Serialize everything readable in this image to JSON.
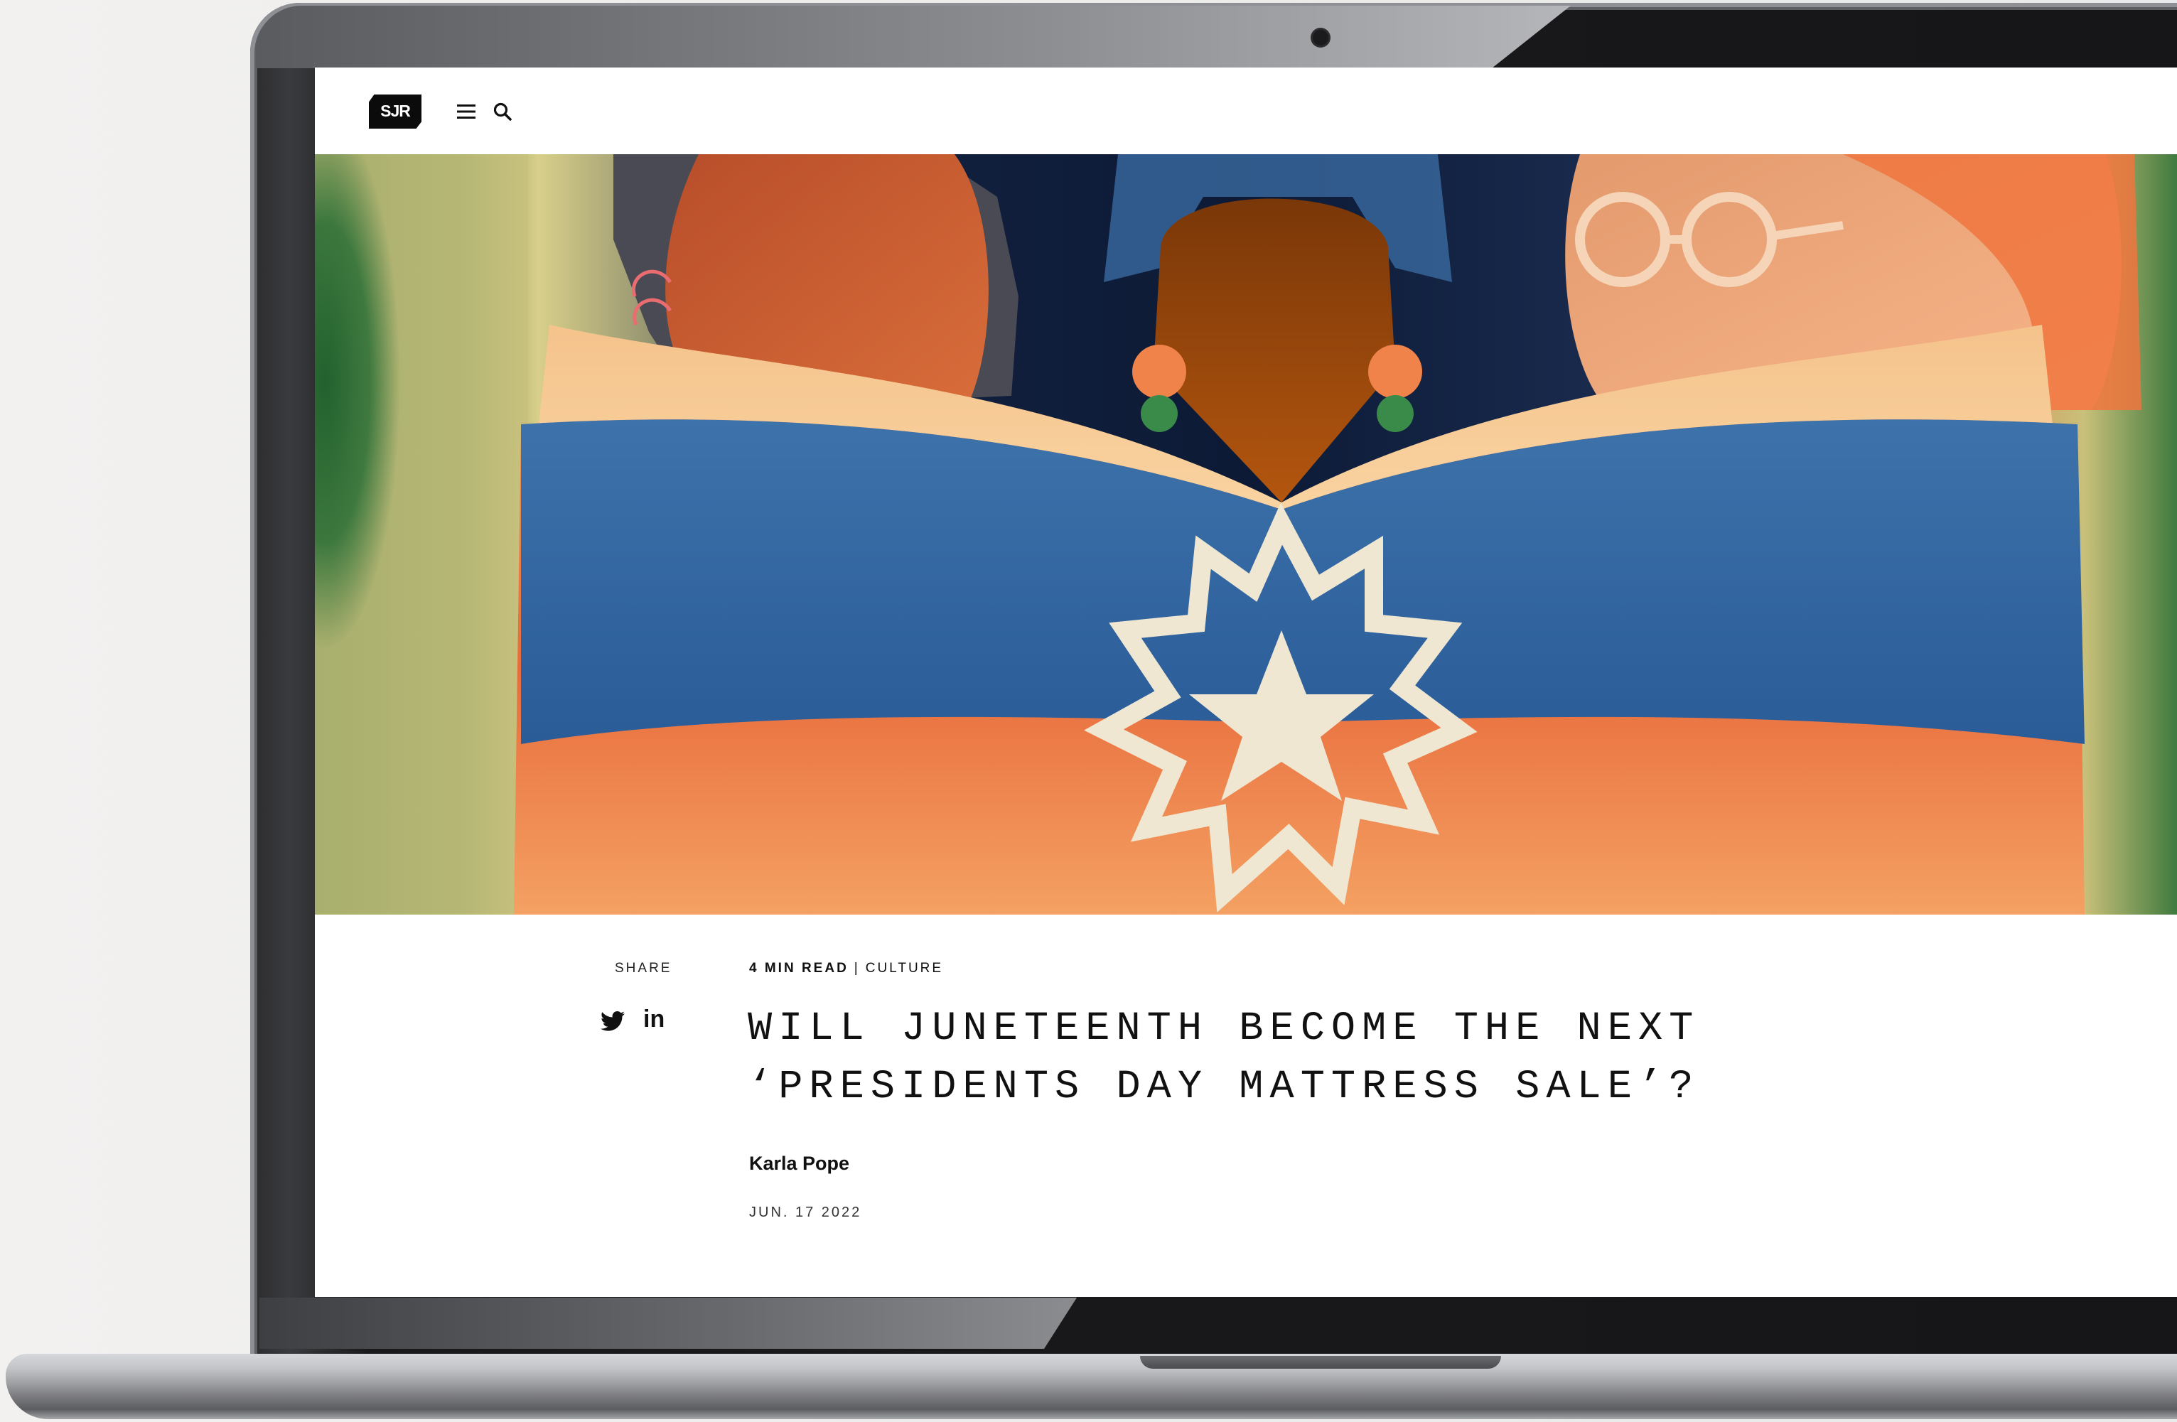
{
  "site": {
    "logo_text": "SJR"
  },
  "nav": {
    "menu_icon": "hamburger-icon",
    "search_icon": "search-icon"
  },
  "hero": {
    "description_icon": "illustration-juneteenth"
  },
  "share": {
    "label": "SHARE",
    "twitter_icon": "twitter-icon",
    "linkedin_text": "in"
  },
  "article": {
    "read_time": "4 MIN READ",
    "separator": "|",
    "category": "CULTURE",
    "headline_line1": "WILL JUNETEENTH BECOME THE NEXT",
    "headline_line2": "‘PRESIDENTS DAY MATTRESS SALE’?",
    "author": "Karla Pope",
    "date": "JUN. 17 2022"
  },
  "colors": {
    "hero_blue": "#2f63a0",
    "hero_orange": "#e8673a",
    "hero_green": "#2b6a35",
    "text": "#111111"
  }
}
